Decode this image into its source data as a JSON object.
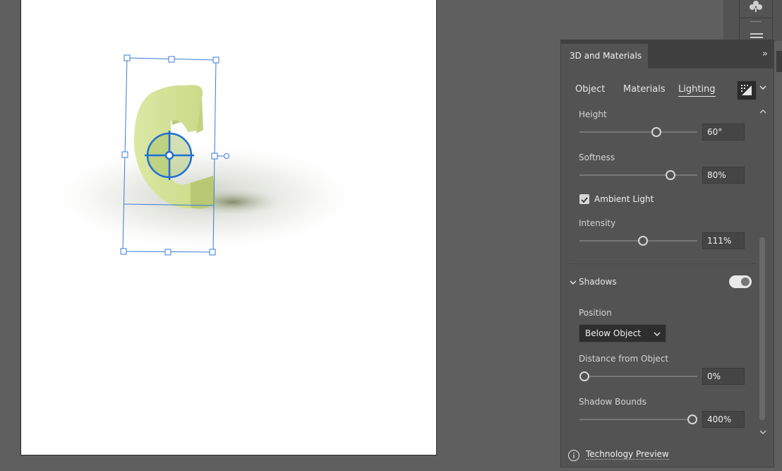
{
  "panel": {
    "title": "3D and Materials",
    "collapse_icon": "double-chevron-right-icon",
    "tabs": [
      "Object",
      "Materials",
      "Lighting"
    ],
    "active_tab": "Lighting",
    "preset_icon": "lighting-preset-icon"
  },
  "lighting": {
    "height": {
      "label": "Height",
      "value": "60°",
      "fraction": 0.65
    },
    "softness": {
      "label": "Softness",
      "value": "80%",
      "fraction": 0.77
    },
    "ambient": {
      "label": "Ambient Light",
      "checked": true
    },
    "intensity": {
      "label": "Intensity",
      "value": "111%",
      "fraction": 0.54
    }
  },
  "shadows": {
    "label": "Shadows",
    "enabled": true,
    "position_label": "Position",
    "position_value": "Below Object",
    "distance": {
      "label": "Distance from Object",
      "value": "0%",
      "fraction": 0.04
    },
    "bounds": {
      "label": "Shadow Bounds",
      "value": "400%",
      "fraction": 0.96
    }
  },
  "footer": {
    "link": "Technology Preview",
    "icon": "info-icon"
  },
  "colors": {
    "accent": "#1f6fd6",
    "object": "#d5e497",
    "panel": "#535353"
  }
}
